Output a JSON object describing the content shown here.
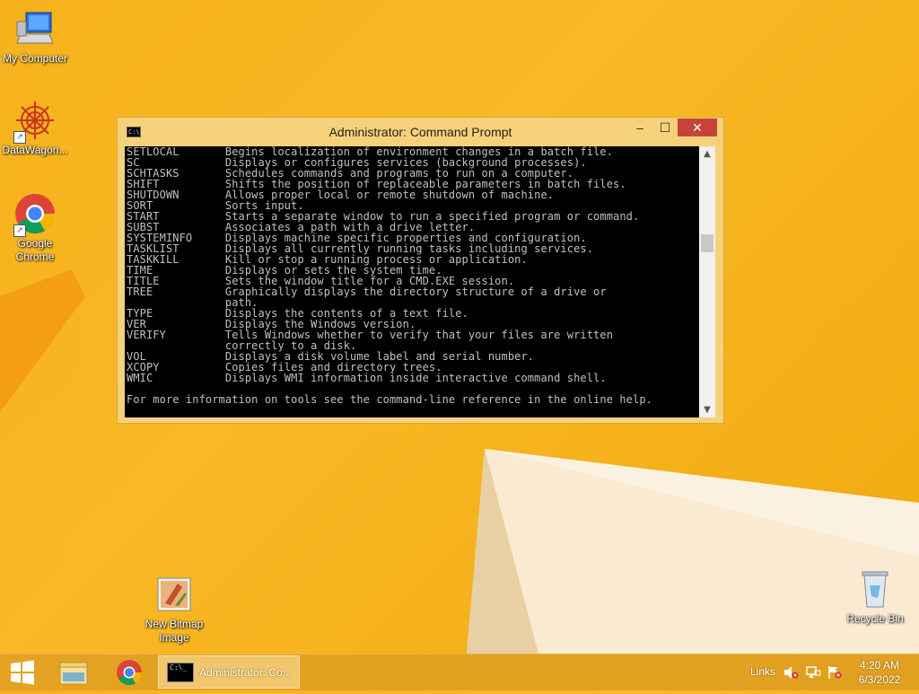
{
  "desktop": {
    "icons": [
      {
        "label": "My Computer"
      },
      {
        "label": "DataWagon..."
      },
      {
        "label": "Google Chrome"
      },
      {
        "label": "New Bitmap Image"
      },
      {
        "label": "Recycle Bin"
      }
    ]
  },
  "window": {
    "title": "Administrator: Command Prompt",
    "console_lines": [
      "SETLOCAL       Begins localization of environment changes in a batch file.",
      "SC             Displays or configures services (background processes).",
      "SCHTASKS       Schedules commands and programs to run on a computer.",
      "SHIFT          Shifts the position of replaceable parameters in batch files.",
      "SHUTDOWN       Allows proper local or remote shutdown of machine.",
      "SORT           Sorts input.",
      "START          Starts a separate window to run a specified program or command.",
      "SUBST          Associates a path with a drive letter.",
      "SYSTEMINFO     Displays machine specific properties and configuration.",
      "TASKLIST       Displays all currently running tasks including services.",
      "TASKKILL       Kill or stop a running process or application.",
      "TIME           Displays or sets the system time.",
      "TITLE          Sets the window title for a CMD.EXE session.",
      "TREE           Graphically displays the directory structure of a drive or",
      "               path.",
      "TYPE           Displays the contents of a text file.",
      "VER            Displays the Windows version.",
      "VERIFY         Tells Windows whether to verify that your files are written",
      "               correctly to a disk.",
      "VOL            Displays a disk volume label and serial number.",
      "XCOPY          Copies files and directory trees.",
      "WMIC           Displays WMI information inside interactive command shell.",
      "",
      "For more information on tools see the command-line reference in the online help."
    ]
  },
  "taskbar": {
    "cmd_task_label": "Administrator: Co...",
    "links_label": "Links",
    "clock_time": "4:20 AM",
    "clock_date": "6/3/2022"
  },
  "colors": {
    "desktop_bg": "#f6b21c",
    "console_bg": "#000000",
    "console_fg": "#c0c0c0",
    "close_button": "#c7433a"
  }
}
